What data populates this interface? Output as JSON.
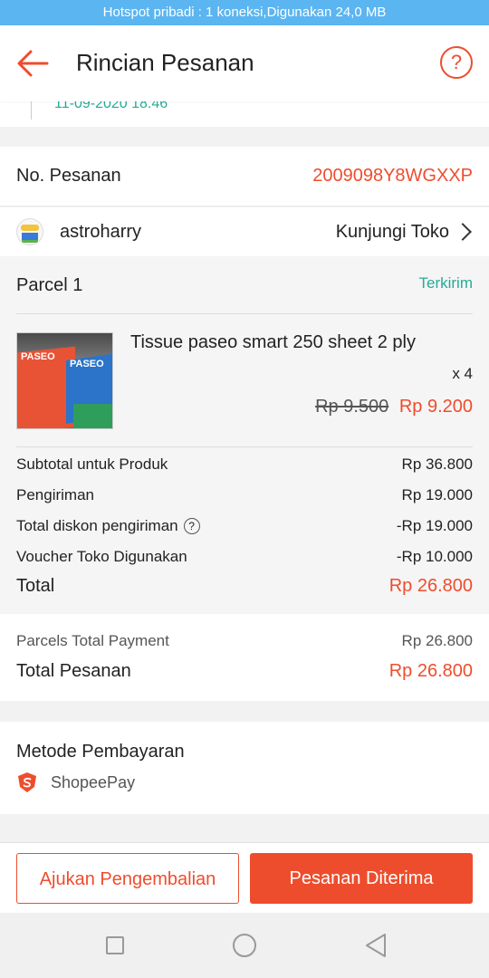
{
  "status_bar": {
    "text": "Hotspot pribadi : 1 koneksi,Digunakan 24,0 MB"
  },
  "header": {
    "title": "Rincian Pesanan",
    "help_label": "?"
  },
  "timeline": {
    "date": "11-09-2020 18:46"
  },
  "order": {
    "label": "No. Pesanan",
    "number": "2009098Y8WGXXP"
  },
  "shop": {
    "name": "astroharry",
    "visit_label": "Kunjungi Toko"
  },
  "parcel": {
    "label": "Parcel 1",
    "status": "Terkirim",
    "product": {
      "name": "Tissue paseo smart 250 sheet 2 ply",
      "qty": "x 4",
      "old_price": "Rp 9.500",
      "price": "Rp 9.200",
      "thumb_text": "PASEO"
    },
    "summary": [
      {
        "label": "Subtotal untuk Produk",
        "value": "Rp 36.800"
      },
      {
        "label": "Pengiriman",
        "value": "Rp 19.000"
      },
      {
        "label": "Total diskon pengiriman",
        "value": "-Rp 19.000"
      },
      {
        "label": "Voucher Toko Digunakan",
        "value": "-Rp 10.000"
      }
    ],
    "total": {
      "label": "Total",
      "value": "Rp 26.800"
    }
  },
  "payment_total": {
    "parcels_label": "Parcels Total Payment",
    "parcels_value": "Rp 26.800",
    "total_label": "Total Pesanan",
    "total_value": "Rp 26.800"
  },
  "payment_method": {
    "label": "Metode Pembayaran",
    "method": "ShopeePay"
  },
  "actions": {
    "return_label": "Ajukan Pengembalian",
    "received_label": "Pesanan Diterima"
  },
  "colors": {
    "accent": "#ee4d2d",
    "status_green": "#26aa99",
    "status_bar": "#5bb5f0"
  }
}
